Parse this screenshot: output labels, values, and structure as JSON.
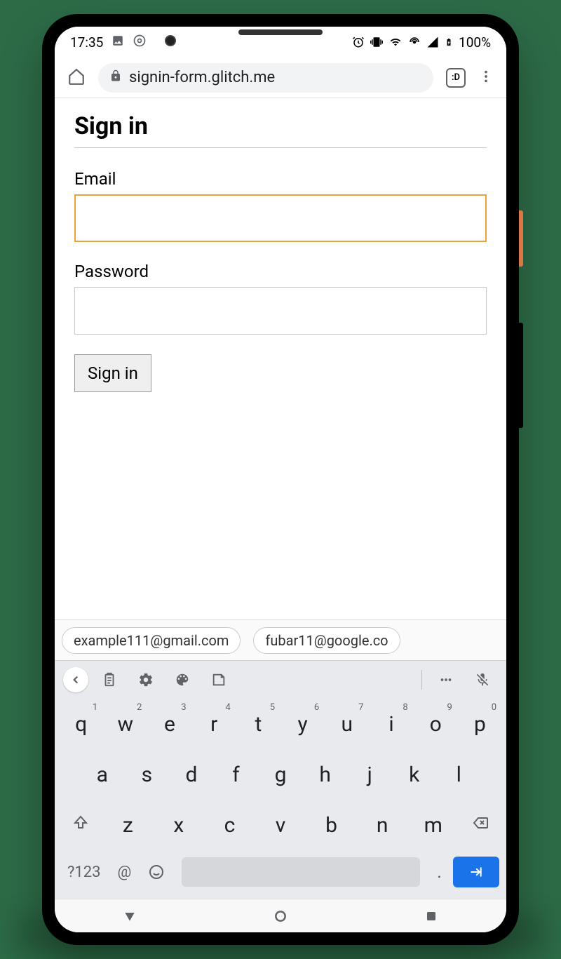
{
  "status": {
    "time": "17:35",
    "battery": "100%"
  },
  "browser": {
    "url": "signin-form.glitch.me",
    "tab_indicator": ":D"
  },
  "page": {
    "title": "Sign in",
    "email_label": "Email",
    "password_label": "Password",
    "signin_button": "Sign in"
  },
  "suggestions": [
    "example111@gmail.com",
    "fubar11@google.co"
  ],
  "keyboard": {
    "row1": [
      {
        "key": "q",
        "num": "1"
      },
      {
        "key": "w",
        "num": "2"
      },
      {
        "key": "e",
        "num": "3"
      },
      {
        "key": "r",
        "num": "4"
      },
      {
        "key": "t",
        "num": "5"
      },
      {
        "key": "y",
        "num": "6"
      },
      {
        "key": "u",
        "num": "7"
      },
      {
        "key": "i",
        "num": "8"
      },
      {
        "key": "o",
        "num": "9"
      },
      {
        "key": "p",
        "num": "0"
      }
    ],
    "row2": [
      "a",
      "s",
      "d",
      "f",
      "g",
      "h",
      "j",
      "k",
      "l"
    ],
    "row3": [
      "z",
      "x",
      "c",
      "v",
      "b",
      "n",
      "m"
    ],
    "sym_key": "?123",
    "at_key": "@",
    "period_key": "."
  }
}
